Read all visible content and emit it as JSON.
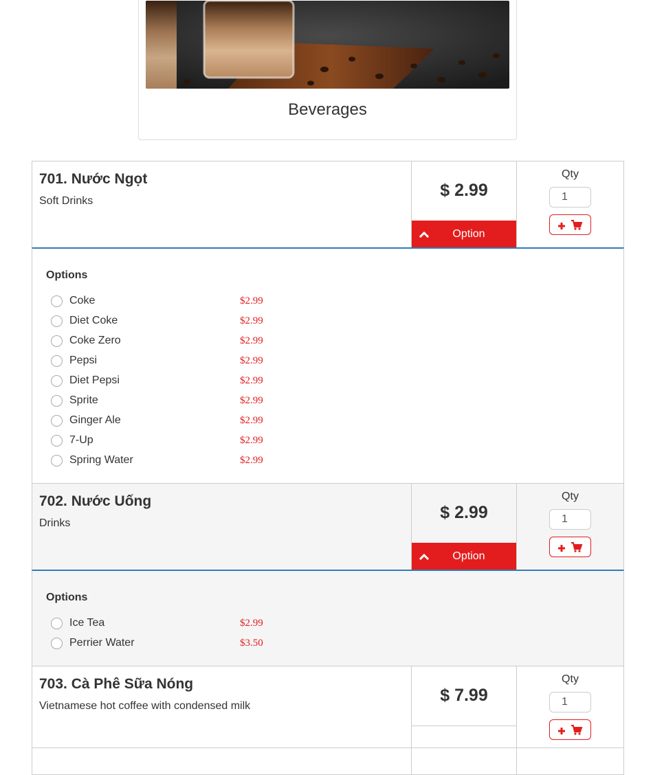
{
  "category": {
    "title": "Beverages",
    "image_alt": "iced coffee glasses on wooden board with coffee beans"
  },
  "qty_label": "Qty",
  "option_label": "Option",
  "options_title": "Options",
  "colors": {
    "accent_red": "#e31d1d",
    "divider_blue": "#337ab7",
    "text": "#333333"
  },
  "items": [
    {
      "name": "701. Nước Ngọt",
      "description": "Soft Drinks",
      "price": "$ 2.99",
      "qty": "1",
      "has_options": true,
      "options": [
        {
          "name": "Coke",
          "price": "$2.99"
        },
        {
          "name": "Diet Coke",
          "price": "$2.99"
        },
        {
          "name": "Coke Zero",
          "price": "$2.99"
        },
        {
          "name": "Pepsi",
          "price": "$2.99"
        },
        {
          "name": "Diet Pepsi",
          "price": "$2.99"
        },
        {
          "name": "Sprite",
          "price": "$2.99"
        },
        {
          "name": "Ginger Ale",
          "price": "$2.99"
        },
        {
          "name": "7-Up",
          "price": "$2.99"
        },
        {
          "name": "Spring Water",
          "price": "$2.99"
        }
      ]
    },
    {
      "name": "702. Nước Uống",
      "description": "Drinks",
      "price": "$ 2.99",
      "qty": "1",
      "has_options": true,
      "options": [
        {
          "name": "Ice Tea",
          "price": "$2.99"
        },
        {
          "name": "Perrier Water",
          "price": "$3.50"
        }
      ]
    },
    {
      "name": "703. Cà Phê Sữa Nóng",
      "description": "Vietnamese hot coffee with condensed milk",
      "price": "$ 7.99",
      "qty": "1",
      "has_options": false,
      "options": []
    }
  ],
  "icons": {
    "option_toggle": "chevron-up-icon",
    "add": "plus-icon",
    "cart": "shopping-cart-icon",
    "radio": "radio-unchecked-icon"
  }
}
